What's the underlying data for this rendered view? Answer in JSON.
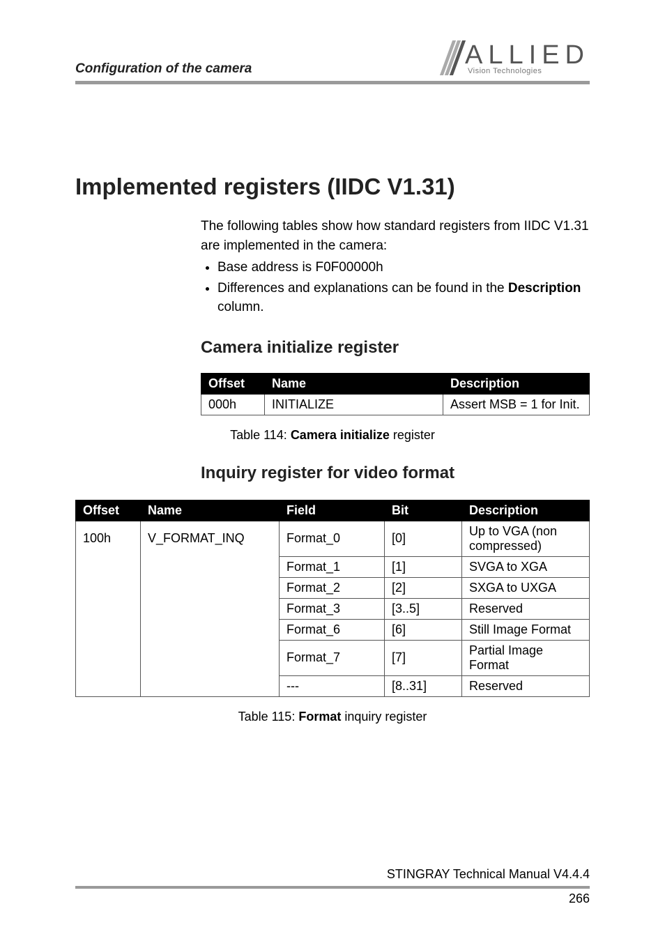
{
  "header": {
    "section_title": "Configuration of the camera"
  },
  "logo": {
    "main": "ALLIED",
    "sub": "Vision Technologies"
  },
  "h1": "Implemented registers (IIDC V1.31)",
  "intro": {
    "para": "The following tables show how standard registers from IIDC V1.31 are implemented in the camera:",
    "b1": "Base address is F0F00000h",
    "b2_pre": "Differences and explanations can be found in the ",
    "b2_bold": "Description",
    "b2_post": " column."
  },
  "h2a": "Camera initialize register",
  "t1": {
    "h_offset": "Offset",
    "h_name": "Name",
    "h_desc": "Description",
    "r1_offset": "000h",
    "r1_name": "INITIALIZE",
    "r1_desc": "Assert MSB = 1 for Init."
  },
  "cap1_pre": "Table 114: ",
  "cap1_b": "Camera initialize",
  "cap1_post": " register",
  "h2b": "Inquiry register for video format",
  "t2": {
    "h_offset": "Offset",
    "h_name": "Name",
    "h_field": "Field",
    "h_bit": "Bit",
    "h_desc": "Description",
    "offset": "100h",
    "name": "V_FORMAT_INQ",
    "rows": [
      {
        "field": "Format_0",
        "bit": "[0]",
        "desc": "Up to VGA (non compressed)"
      },
      {
        "field": "Format_1",
        "bit": "[1]",
        "desc": "SVGA to XGA"
      },
      {
        "field": "Format_2",
        "bit": "[2]",
        "desc": "SXGA to UXGA"
      },
      {
        "field": "Format_3",
        "bit": "[3..5]",
        "desc": "Reserved"
      },
      {
        "field": "Format_6",
        "bit": "[6]",
        "desc": "Still Image Format"
      },
      {
        "field": "Format_7",
        "bit": "[7]",
        "desc": "Partial Image Format"
      },
      {
        "field": "---",
        "bit": "[8..31]",
        "desc": "Reserved"
      }
    ]
  },
  "cap2_pre": "Table 115: ",
  "cap2_b": "Format",
  "cap2_post": " inquiry register",
  "footer": {
    "doc": "STINGRAY Technical Manual V4.4.4",
    "page": "266"
  }
}
